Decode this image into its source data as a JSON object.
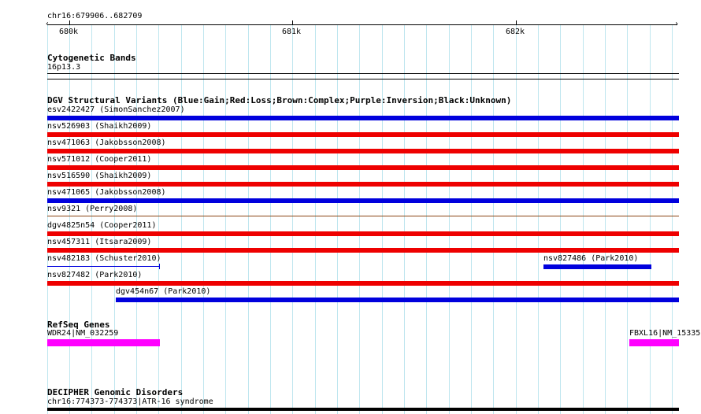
{
  "ruler": {
    "range_label": "chr16:679906..682709",
    "tick_labels": [
      "680k",
      "681k",
      "682k"
    ]
  },
  "tracks": {
    "cytoband": {
      "title": "Cytogenetic Bands",
      "band_label": "16p13.3"
    },
    "dgv": {
      "title": "DGV Structural Variants (Blue:Gain;Red:Loss;Brown:Complex;Purple:Inversion;Black:Unknown)",
      "variants": [
        {
          "label": "esv2422427 (SimonSanchez2007)",
          "type": "gain"
        },
        {
          "label": "nsv526903 (Shaikh2009)",
          "type": "loss"
        },
        {
          "label": "nsv471063 (Jakobsson2008)",
          "type": "loss"
        },
        {
          "label": "nsv571012 (Cooper2011)",
          "type": "loss"
        },
        {
          "label": "nsv516590 (Shaikh2009)",
          "type": "loss"
        },
        {
          "label": "nsv471065 (Jakobsson2008)",
          "type": "gain"
        },
        {
          "label": "nsv9321 (Perry2008)",
          "type": "complex"
        },
        {
          "label": "dgv4825n54 (Cooper2011)",
          "type": "loss"
        },
        {
          "label": "nsv457311 (Itsara2009)",
          "type": "loss"
        },
        {
          "label": "nsv482183 (Schuster2010)",
          "type": "gain"
        },
        {
          "label": "nsv827486 (Park2010)",
          "type": "gain"
        },
        {
          "label": "nsv827482 (Park2010)",
          "type": "loss"
        },
        {
          "label": "dgv454n67 (Park2010)",
          "type": "gain"
        }
      ]
    },
    "refseq": {
      "title": "RefSeq Genes",
      "genes": [
        {
          "label": "WDR24|NM_032259"
        },
        {
          "label": "FBXL16|NM_15335"
        }
      ]
    },
    "decipher": {
      "title": "DECIPHER Genomic Disorders",
      "items": [
        {
          "label": "chr16:774373-774373|ATR-16 syndrome"
        }
      ]
    }
  },
  "colors": {
    "gain": "#0000dd",
    "loss": "#ee0000",
    "complex": "#8b4513",
    "gene": "#ff00ff",
    "grid": "#bfe6ef"
  }
}
